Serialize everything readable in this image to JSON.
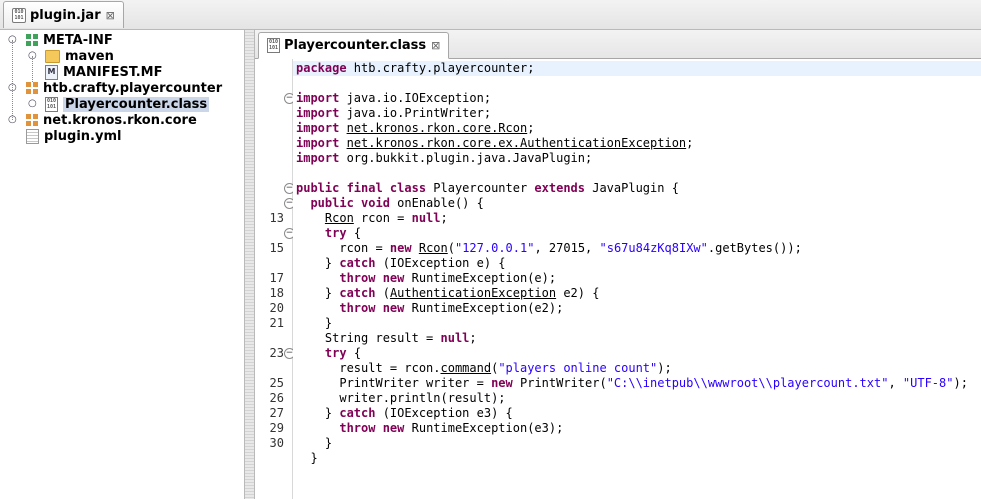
{
  "top_tab": {
    "label": "plugin.jar",
    "close": "⊠",
    "icon": "jar-icon"
  },
  "tree": {
    "items": [
      {
        "label": "META-INF",
        "icon": "package-icon"
      },
      {
        "label": "maven",
        "icon": "folder-icon"
      },
      {
        "label": "MANIFEST.MF",
        "icon": "manifest-icon",
        "icon_letter": "M"
      },
      {
        "label": "htb.crafty.playercounter",
        "icon": "package-icon"
      },
      {
        "label": "Playercounter.class",
        "icon": "class-icon",
        "selected": true
      },
      {
        "label": "net.kronos.rkon.core",
        "icon": "package-icon"
      },
      {
        "label": "plugin.yml",
        "icon": "yml-icon"
      }
    ]
  },
  "editor": {
    "tab_label": "Playercounter.class",
    "tab_close": "⊠",
    "line_numbers": [
      "",
      "",
      "",
      "",
      "",
      "",
      "",
      "",
      "",
      "",
      "13",
      "",
      "15",
      "",
      "17",
      "18",
      "20",
      "21",
      "",
      "23",
      "",
      "25",
      "26",
      "27",
      "29",
      "30",
      "",
      ""
    ],
    "code": [
      [
        {
          "t": "package",
          "c": "kw"
        },
        {
          "t": " htb.crafty.playercounter;"
        }
      ],
      [],
      [
        {
          "t": "import",
          "c": "kw"
        },
        {
          "t": " java.io.IOException;"
        }
      ],
      [
        {
          "t": "import",
          "c": "kw"
        },
        {
          "t": " java.io.PrintWriter;"
        }
      ],
      [
        {
          "t": "import",
          "c": "kw"
        },
        {
          "t": " "
        },
        {
          "t": "net.kronos.rkon.core.Rcon",
          "c": "ul"
        },
        {
          "t": ";"
        }
      ],
      [
        {
          "t": "import",
          "c": "kw"
        },
        {
          "t": " "
        },
        {
          "t": "net.kronos.rkon.core.ex.AuthenticationException",
          "c": "ul"
        },
        {
          "t": ";"
        }
      ],
      [
        {
          "t": "import",
          "c": "kw"
        },
        {
          "t": " org.bukkit.plugin.java.JavaPlugin;"
        }
      ],
      [],
      [
        {
          "t": "public final class",
          "c": "kw"
        },
        {
          "t": " Playercounter "
        },
        {
          "t": "extends",
          "c": "kw"
        },
        {
          "t": " JavaPlugin {"
        }
      ],
      [
        {
          "t": "  "
        },
        {
          "t": "public void",
          "c": "kw"
        },
        {
          "t": " onEnable() {"
        }
      ],
      [
        {
          "t": "    "
        },
        {
          "t": "Rcon",
          "c": "ul"
        },
        {
          "t": " rcon = "
        },
        {
          "t": "null",
          "c": "kw"
        },
        {
          "t": ";"
        }
      ],
      [
        {
          "t": "    "
        },
        {
          "t": "try",
          "c": "kw"
        },
        {
          "t": " {"
        }
      ],
      [
        {
          "t": "      rcon = "
        },
        {
          "t": "new",
          "c": "kw"
        },
        {
          "t": " "
        },
        {
          "t": "Rcon",
          "c": "ul"
        },
        {
          "t": "("
        },
        {
          "t": "\"127.0.0.1\"",
          "c": "str"
        },
        {
          "t": ", 27015, "
        },
        {
          "t": "\"s67u84zKq8IXw\"",
          "c": "str"
        },
        {
          "t": ".getBytes());"
        }
      ],
      [
        {
          "t": "    } "
        },
        {
          "t": "catch",
          "c": "kw"
        },
        {
          "t": " (IOException e) {"
        }
      ],
      [
        {
          "t": "      "
        },
        {
          "t": "throw new",
          "c": "kw"
        },
        {
          "t": " RuntimeException(e);"
        }
      ],
      [
        {
          "t": "    } "
        },
        {
          "t": "catch",
          "c": "kw"
        },
        {
          "t": " ("
        },
        {
          "t": "AuthenticationException",
          "c": "ul"
        },
        {
          "t": " e2) {"
        }
      ],
      [
        {
          "t": "      "
        },
        {
          "t": "throw new",
          "c": "kw"
        },
        {
          "t": " RuntimeException(e2);"
        }
      ],
      [
        {
          "t": "    }"
        }
      ],
      [
        {
          "t": "    String result = "
        },
        {
          "t": "null",
          "c": "kw"
        },
        {
          "t": ";"
        }
      ],
      [
        {
          "t": "    "
        },
        {
          "t": "try",
          "c": "kw"
        },
        {
          "t": " {"
        }
      ],
      [
        {
          "t": "      result = rcon."
        },
        {
          "t": "command",
          "c": "ul"
        },
        {
          "t": "("
        },
        {
          "t": "\"players online count\"",
          "c": "str"
        },
        {
          "t": ");"
        }
      ],
      [
        {
          "t": "      PrintWriter writer = "
        },
        {
          "t": "new",
          "c": "kw"
        },
        {
          "t": " PrintWriter("
        },
        {
          "t": "\"C:\\\\inetpub\\\\wwwroot\\\\playercount.txt\"",
          "c": "str"
        },
        {
          "t": ", "
        },
        {
          "t": "\"UTF-8\"",
          "c": "str"
        },
        {
          "t": ");"
        }
      ],
      [
        {
          "t": "      writer.println(result);"
        }
      ],
      [
        {
          "t": "    } "
        },
        {
          "t": "catch",
          "c": "kw"
        },
        {
          "t": " (IOException e3) {"
        }
      ],
      [
        {
          "t": "      "
        },
        {
          "t": "throw new",
          "c": "kw"
        },
        {
          "t": " RuntimeException(e3);"
        }
      ],
      [
        {
          "t": "    }"
        }
      ],
      [
        {
          "t": "  }"
        }
      ]
    ]
  },
  "colors": {
    "keyword": "#7f0055",
    "string": "#2a00ff",
    "selection": "#cbd6e8",
    "current_line": "#e8f2fe"
  }
}
